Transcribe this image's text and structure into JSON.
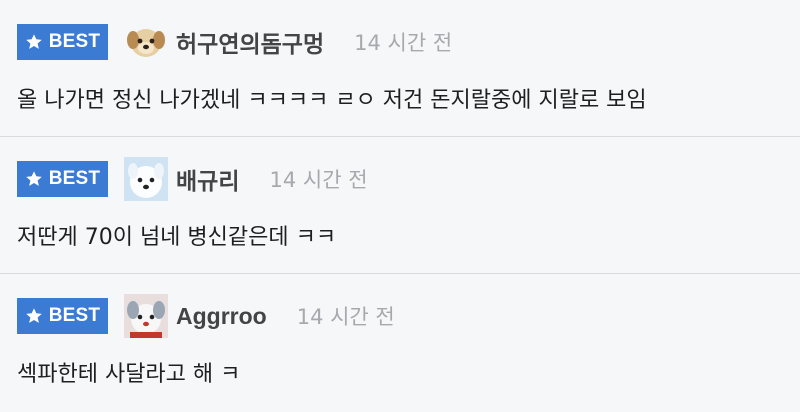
{
  "comments": [
    {
      "badge": "BEST",
      "username": "허구연의돔구멍",
      "time": "14 시간 전",
      "text": "올 나가면 정신 나가겠네 ㅋㅋㅋㅋ ㄹㅇ 저건 돈지랄중에 지랄로 보임",
      "avatar_icon": "puppy-avatar-icon"
    },
    {
      "badge": "BEST",
      "username": "배규리",
      "time": "14 시간 전",
      "text": "저딴게 70이 넘네 병신같은데 ㅋㅋ",
      "avatar_icon": "white-dog-avatar-icon"
    },
    {
      "badge": "BEST",
      "username": "Aggrroo",
      "time": "14 시간 전",
      "text": "섹파한테 사달라고 해 ㅋ",
      "avatar_icon": "white-dog-avatar-icon"
    }
  ],
  "colors": {
    "badge_bg": "#3c7bd4",
    "time": "#a6a9ae",
    "background": "#f6f7f9"
  }
}
